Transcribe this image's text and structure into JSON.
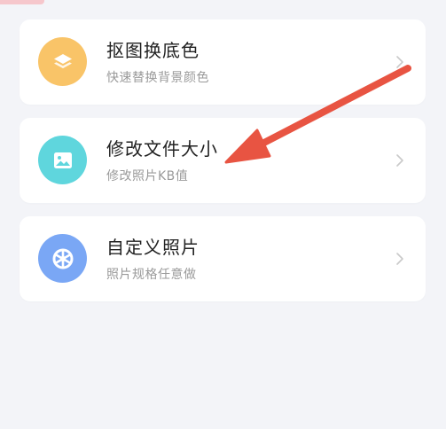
{
  "items": [
    {
      "title": "抠图换底色",
      "subtitle": "快速替换背景颜色",
      "icon": "layers-icon",
      "color": "#f9c468"
    },
    {
      "title": "修改文件大小",
      "subtitle": "修改照片KB值",
      "icon": "image-icon",
      "color": "#5fd6dd"
    },
    {
      "title": "自定义照片",
      "subtitle": "照片规格任意做",
      "icon": "aperture-icon",
      "color": "#7aa7f5"
    }
  ],
  "annotation": {
    "color": "#e85442",
    "icon": "arrow-pointer-icon"
  }
}
